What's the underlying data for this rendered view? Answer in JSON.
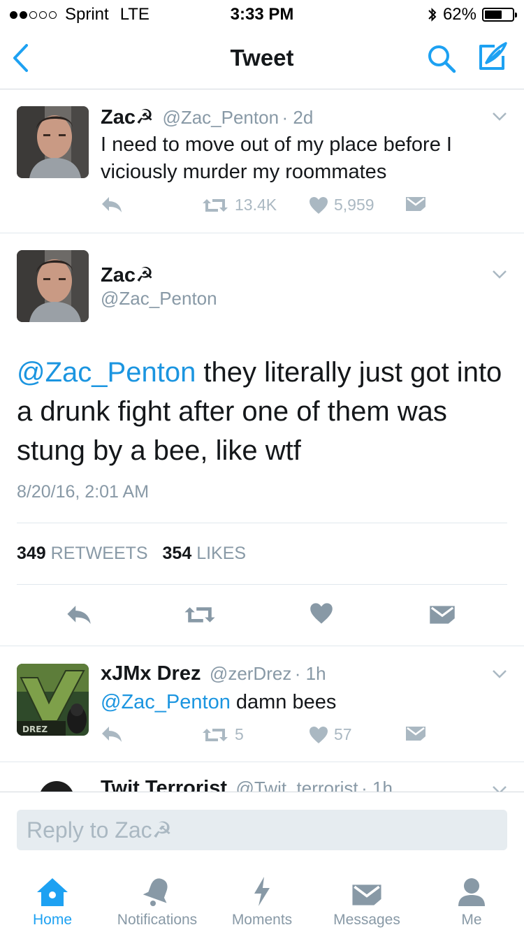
{
  "status_bar": {
    "carrier": "Sprint",
    "network": "LTE",
    "time": "3:33 PM",
    "battery": "62%",
    "battery_level": 0.62,
    "signal_bars": 2
  },
  "nav": {
    "title": "Tweet"
  },
  "tweets": [
    {
      "name": "Zac☭",
      "handle": "@Zac_Penton",
      "age": "· 2d",
      "text": "I need to move out of my place before I viciously murder my roommates",
      "retweets": "13.4K",
      "likes": "5,959"
    },
    {
      "name": "xJMx Drez",
      "handle": "@zerDrez",
      "age": "· 1h",
      "mention": "@Zac_Penton",
      "text": " damn bees",
      "avatar_label": "DREZ",
      "retweets": "5",
      "likes": "57"
    },
    {
      "name": "Twit Terrorist",
      "handle": "@Twit_terrorist",
      "age": "· 1h"
    }
  ],
  "detail": {
    "name": "Zac☭",
    "handle": "@Zac_Penton",
    "mention": "@Zac_Penton",
    "text": " they literally just got into a drunk fight after one of them was stung by a bee, like wtf",
    "timestamp": "8/20/16, 2:01 AM",
    "retweet_count": "349",
    "retweet_label": "RETWEETS",
    "like_count": "354",
    "like_label": "LIKES"
  },
  "reply": {
    "placeholder": "Reply to Zac☭"
  },
  "tabs": [
    {
      "label": "Home",
      "icon": "home-icon",
      "active": true
    },
    {
      "label": "Notifications",
      "icon": "bell-icon",
      "active": false
    },
    {
      "label": "Moments",
      "icon": "lightning-icon",
      "active": false
    },
    {
      "label": "Messages",
      "icon": "envelope-icon",
      "active": false
    },
    {
      "label": "Me",
      "icon": "person-icon",
      "active": false
    }
  ],
  "colors": {
    "accent": "#1da1f2",
    "link": "#1b95e0",
    "muted": "#8899a6",
    "icon_gray": "#aab8c2",
    "text": "#14171a"
  }
}
